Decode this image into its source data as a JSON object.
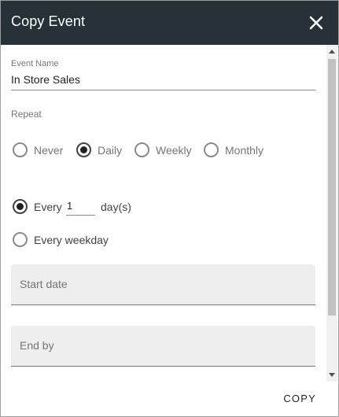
{
  "dialog": {
    "title": "Copy Event",
    "close_icon": "close-icon"
  },
  "event": {
    "label": "Event Name",
    "value": "In Store Sales"
  },
  "repeat": {
    "label": "Repeat",
    "options": [
      "Never",
      "Daily",
      "Weekly",
      "Monthly"
    ],
    "selected": "Daily"
  },
  "frequency": {
    "every_label": "Every",
    "every_value": "1",
    "unit_label": "day(s)",
    "weekday_label": "Every weekday",
    "selected": "every"
  },
  "start_date": {
    "placeholder": "Start date"
  },
  "end_by": {
    "placeholder": "End by"
  },
  "actions": {
    "copy_label": "COPY"
  },
  "colors": {
    "header_bg": "#263238",
    "header_text": "#ffffff",
    "field_bg": "#eeeeee"
  }
}
